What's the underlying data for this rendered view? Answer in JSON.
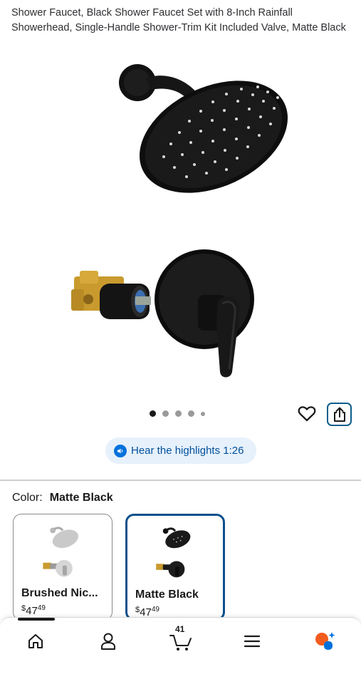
{
  "product": {
    "title": "Shower Faucet, Black Shower Faucet Set with 8-Inch Rainfall Showerhead, Single-Handle Shower-Trim Kit Included Valve, Matte Black"
  },
  "gallery": {
    "image_count": 5,
    "active_index": 0
  },
  "actions": {
    "favorite_icon": "heart-icon",
    "share_icon": "share-icon"
  },
  "audio": {
    "label": "Hear the highlights 1:26"
  },
  "color": {
    "label": "Color:",
    "selected": "Matte Black",
    "options": [
      {
        "name": "Brushed Nic...",
        "currency": "$",
        "dollars": "47",
        "cents": "49"
      },
      {
        "name": "Matte Black",
        "currency": "$",
        "dollars": "47",
        "cents": "49"
      }
    ]
  },
  "nav": {
    "cart_count": "41",
    "items": [
      "home-icon",
      "account-icon",
      "cart-icon",
      "menu-icon",
      "assistant-icon"
    ]
  },
  "colors": {
    "accent": "#0d5e8c",
    "highlight_bg": "#e6f1fc",
    "highlight_text": "#004f9a",
    "selected_border": "#0d4f8c"
  }
}
